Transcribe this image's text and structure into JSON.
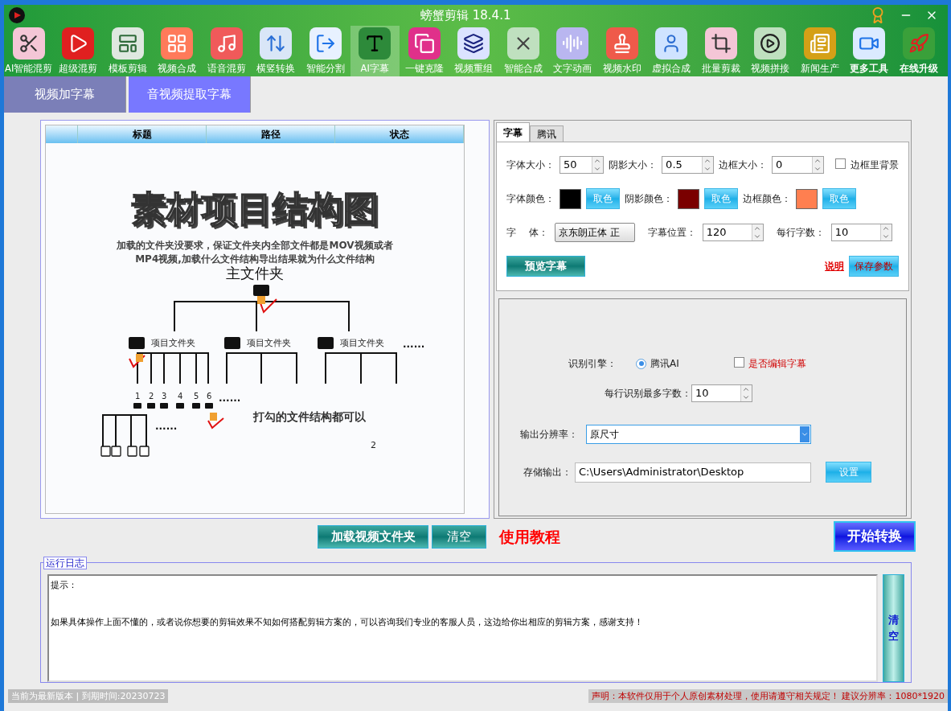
{
  "window": {
    "title": "螃蟹剪辑 18.4.1"
  },
  "tools": [
    {
      "label": "AI智能混剪",
      "selected": false
    },
    {
      "label": "超级混剪",
      "selected": false
    },
    {
      "label": "模板剪辑",
      "selected": false
    },
    {
      "label": "视频合成",
      "selected": false
    },
    {
      "label": "语音混剪",
      "selected": false
    },
    {
      "label": "横竖转换",
      "selected": false
    },
    {
      "label": "智能分割",
      "selected": false
    },
    {
      "label": "AI字幕",
      "selected": true
    },
    {
      "label": "一键克隆",
      "selected": false
    },
    {
      "label": "视频重组",
      "selected": false
    },
    {
      "label": "智能合成",
      "selected": false
    },
    {
      "label": "文字动画",
      "selected": false
    },
    {
      "label": "视频水印",
      "selected": false
    },
    {
      "label": "虚拟合成",
      "selected": false
    },
    {
      "label": "批量剪裁",
      "selected": false
    },
    {
      "label": "视频拼接",
      "selected": false
    },
    {
      "label": "新闻生产",
      "selected": false
    },
    {
      "label": "更多工具",
      "selected": false
    },
    {
      "label": "在线升级",
      "selected": false
    }
  ],
  "mode_tabs": [
    {
      "label": "视频加字幕",
      "selected": false
    },
    {
      "label": "音视频提取字幕",
      "selected": true
    }
  ],
  "file_table": {
    "columns": [
      "标题",
      "路径",
      "状态"
    ]
  },
  "diagram": {
    "title": "素材项目结构图",
    "note_lines": [
      "加载的文件夹没要求，保证文件夹内全部文件都是MOV视频或者",
      "MP4视频,加载什么文件结构导出结果就为什么文件结构"
    ],
    "root": "主文件夹",
    "folders": [
      "项目文件夹",
      "项目文件夹",
      "项目文件夹"
    ],
    "more": [
      "......",
      "......",
      "......"
    ],
    "numbers": [
      "1",
      "2",
      "3",
      "4",
      "5",
      "6"
    ],
    "caption": "打勾的文件结构都可以",
    "mark": "2"
  },
  "settings_tabs": [
    {
      "label": "字幕",
      "selected": true
    },
    {
      "label": "腾讯",
      "selected": false
    }
  ],
  "subtitle_settings": {
    "spinners_row1": [
      {
        "label": "字体大小：",
        "value": "50"
      },
      {
        "label": "阴影大小：",
        "value": "0.5"
      },
      {
        "label": "边框大小：",
        "value": "0"
      }
    ],
    "border_background": {
      "label": "边框里背景",
      "checked": false
    },
    "colors": [
      {
        "label": "字体颜色：",
        "color": "#000000",
        "button": "取色"
      },
      {
        "label": "阴影颜色：",
        "color": "#7a0000",
        "button": "取色"
      },
      {
        "label": "边框颜色：",
        "color": "#ff7f50",
        "button": "取色"
      }
    ],
    "font": {
      "label": "字　 体：",
      "value": "京东朗正体 正"
    },
    "spinners_row3": [
      {
        "label": "字幕位置：",
        "value": "120"
      },
      {
        "label": "每行字数：",
        "value": "10"
      }
    ],
    "preview_button": "预览字幕",
    "help_link": "说明",
    "save_button": "保存参数"
  },
  "recognition": {
    "engine_label": "识别引擎：",
    "engines": [
      {
        "label": "腾讯AI",
        "selected": true
      }
    ],
    "edit_subtitles": {
      "label": "是否编辑字幕",
      "checked": false
    },
    "max_chars": {
      "label": "每行识别最多字数：",
      "value": "10"
    },
    "resolution": {
      "label": "输出分辨率：",
      "value": "原尺寸"
    },
    "output": {
      "label": "存储输出：",
      "value": "C:\\Users\\Administrator\\Desktop",
      "button": "设置"
    }
  },
  "actions": {
    "load_button": "加载视频文件夹",
    "clear_button": "清空",
    "tutorial_link": "使用教程",
    "start_button": "开始转换"
  },
  "log": {
    "title": "运行日志",
    "lines": [
      "提示：",
      "如果具体操作上面不懂的，或者说你想要的剪辑效果不知如何搭配剪辑方案的，可以咨询我们专业的客服人员，这边给你出相应的剪辑方案，感谢支持！"
    ],
    "clear_button": "清空"
  },
  "status_bar": {
    "version": "当前为最新版本 | 到期时间:20230723",
    "notice": "声明：本软件仅用于个人原创素材处理，使用请遵守相关规定！ 建议分辨率：1080*1920"
  }
}
